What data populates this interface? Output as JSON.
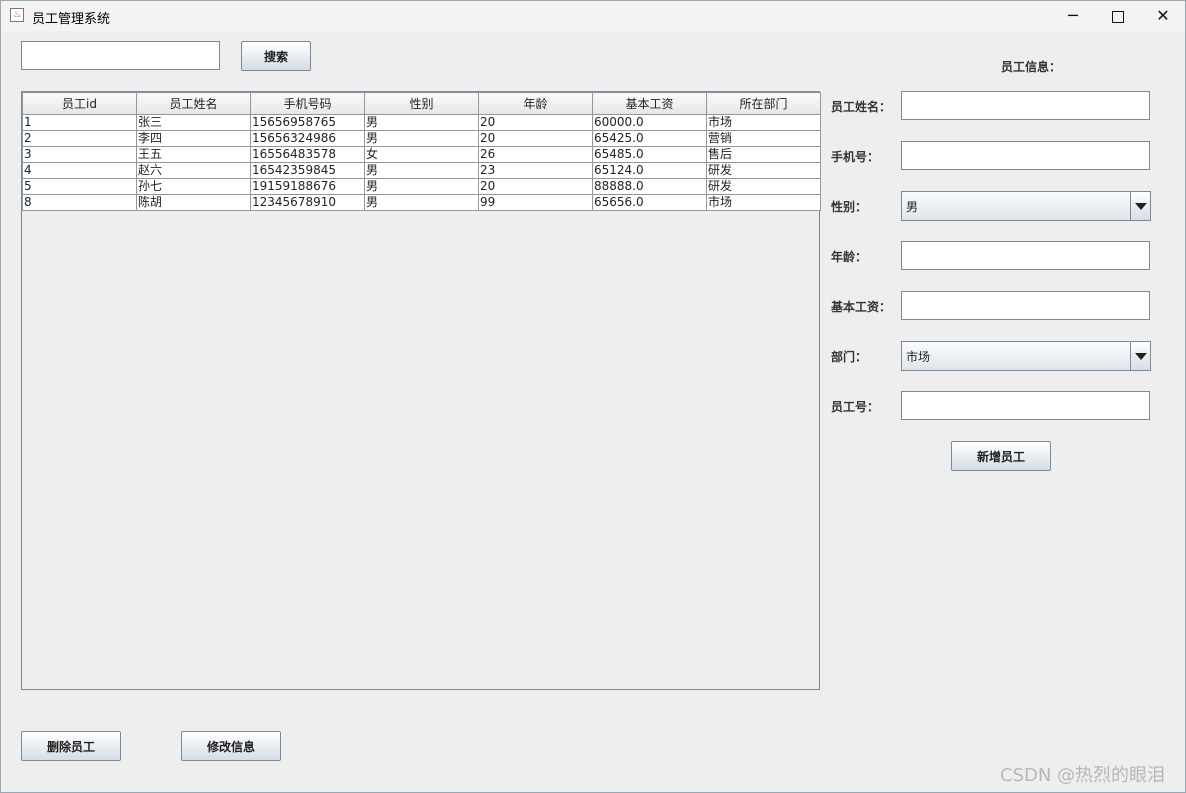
{
  "window": {
    "title": "员工管理系统"
  },
  "search": {
    "value": "",
    "placeholder": "",
    "button": "搜索"
  },
  "table": {
    "columns": [
      "员工id",
      "员工姓名",
      "手机号码",
      "性别",
      "年龄",
      "基本工资",
      "所在部门"
    ],
    "rows": [
      [
        "1",
        "张三",
        "15656958765",
        "男",
        "20",
        "60000.0",
        "市场"
      ],
      [
        "2",
        "李四",
        "15656324986",
        "男",
        "20",
        "65425.0",
        "营销"
      ],
      [
        "3",
        "王五",
        "16556483578",
        "女",
        "26",
        "65485.0",
        "售后"
      ],
      [
        "4",
        "赵六",
        "16542359845",
        "男",
        "23",
        "65124.0",
        "研发"
      ],
      [
        "5",
        "孙七",
        "19159188676",
        "男",
        "20",
        "88888.0",
        "研发"
      ],
      [
        "8",
        "陈胡",
        "12345678910",
        "男",
        "99",
        "65656.0",
        "市场"
      ]
    ]
  },
  "form": {
    "title": "员工信息：",
    "name_label": "员工姓名：",
    "name_value": "",
    "phone_label": "手机号：",
    "phone_value": "",
    "gender_label": "性别：",
    "gender_value": "男",
    "age_label": "年龄：",
    "age_value": "",
    "salary_label": "基本工资：",
    "salary_value": "",
    "dept_label": "部门：",
    "dept_value": "市场",
    "empno_label": "员工号：",
    "empno_value": "",
    "add_button": "新增员工"
  },
  "actions": {
    "delete_button": "删除员工",
    "edit_button": "修改信息"
  },
  "watermark": "CSDN @热烈的眼泪"
}
